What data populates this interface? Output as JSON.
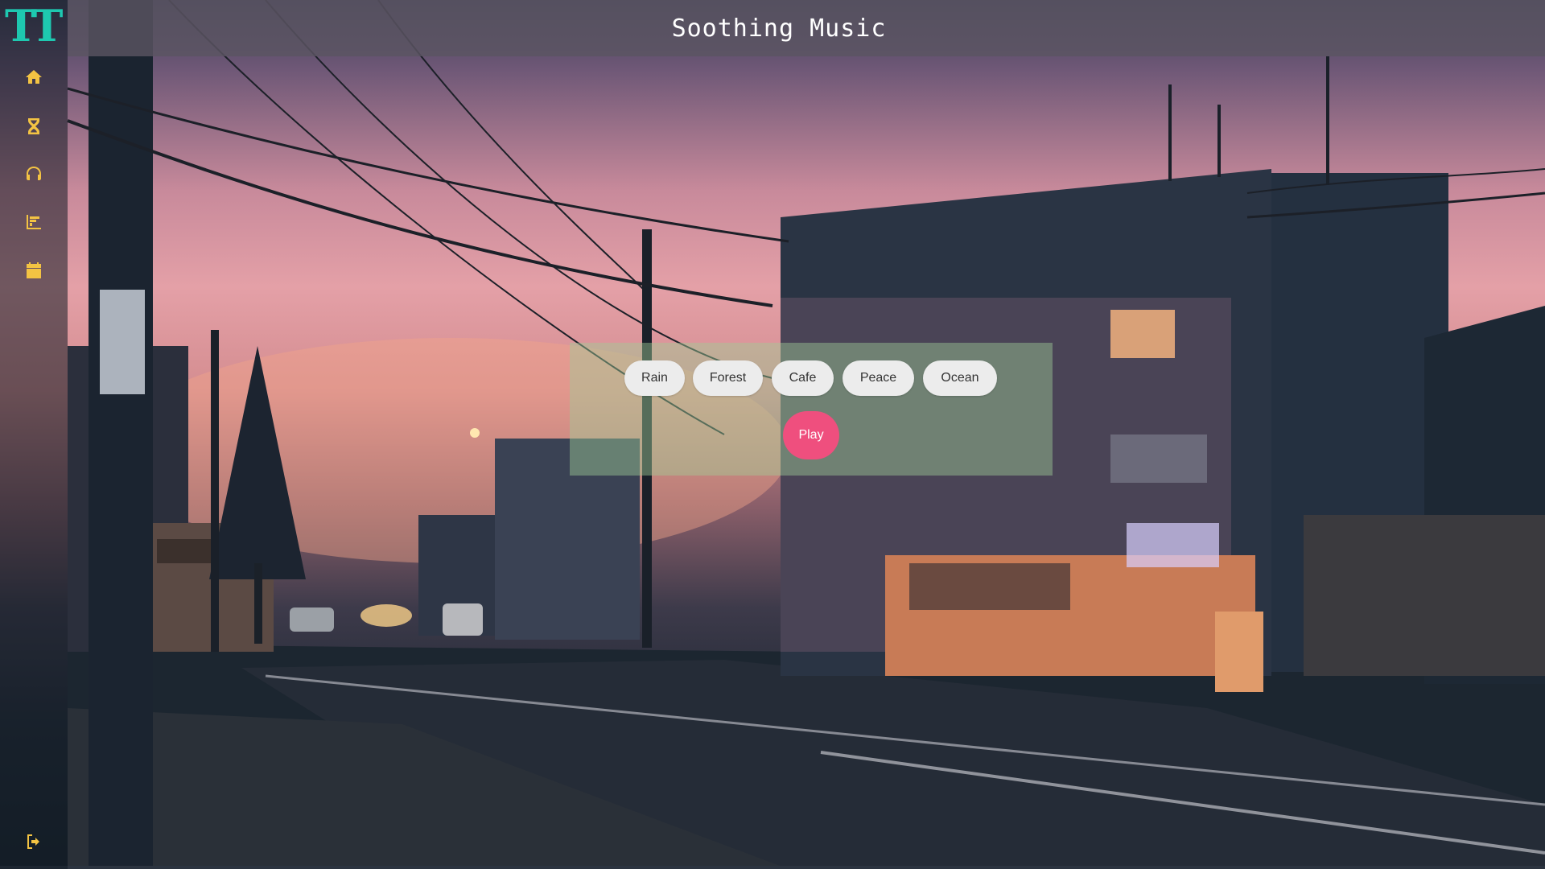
{
  "app": {
    "logo_text": "TT",
    "title": "Soothing Music"
  },
  "sidebar": {
    "items": [
      {
        "icon": "home-icon"
      },
      {
        "icon": "hourglass-icon"
      },
      {
        "icon": "headphones-icon"
      },
      {
        "icon": "bar-chart-icon"
      },
      {
        "icon": "calendar-icon"
      }
    ],
    "logout_icon": "logout-icon",
    "icon_color": "#f3c343",
    "logo_color": "#1ec8b0"
  },
  "sounds": {
    "options": [
      "Rain",
      "Forest",
      "Cafe",
      "Peace",
      "Ocean"
    ],
    "play_label": "Play",
    "play_color": "#ef4f7e"
  }
}
